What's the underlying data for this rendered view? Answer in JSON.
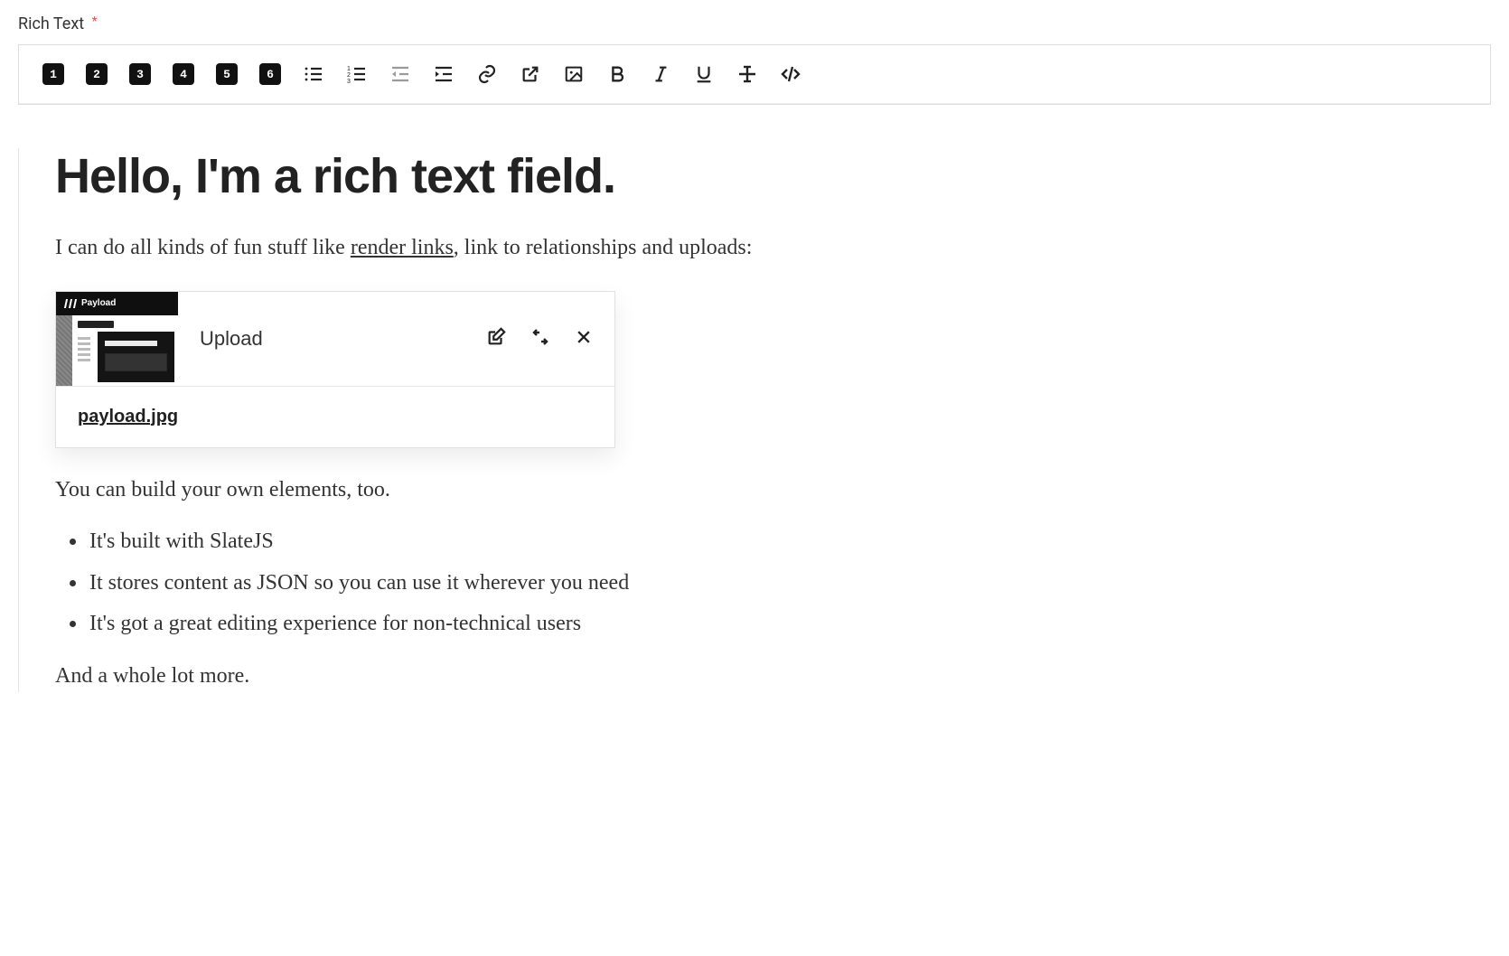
{
  "field": {
    "label": "Rich Text",
    "required_mark": "*"
  },
  "toolbar": {
    "headings": [
      "1",
      "2",
      "3",
      "4",
      "5",
      "6"
    ]
  },
  "content": {
    "heading": "Hello, I'm a rich text field.",
    "para1_pre": "I can do all kinds of fun stuff like ",
    "para1_link": "render links",
    "para1_post": ", link to relationships and uploads:",
    "upload": {
      "title": "Upload",
      "thumb_brand": "Payload",
      "filename": "payload.jpg"
    },
    "para2": "You can build your own elements, too.",
    "bullets": [
      "It's built with SlateJS",
      "It stores content as JSON so you can use it wherever you need",
      "It's got a great editing experience for non-technical users"
    ],
    "para3": "And a whole lot more."
  }
}
